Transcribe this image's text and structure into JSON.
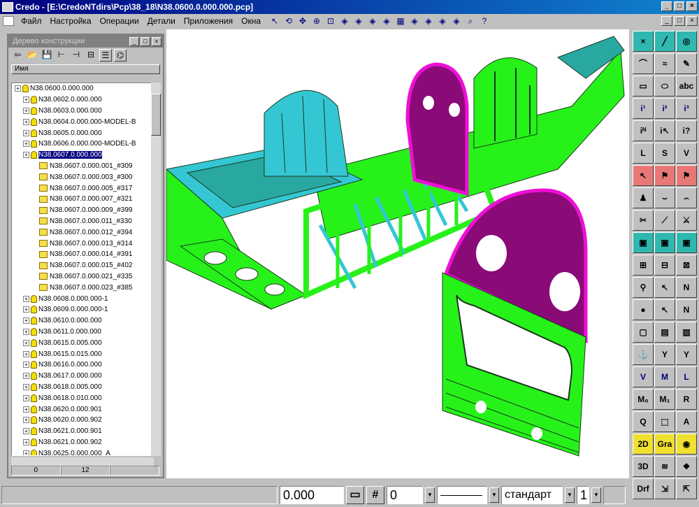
{
  "window": {
    "title": "Credo - [E:\\CredoNTdirs\\Pcp\\38_18\\N38.0600.0.000.000.pcp]",
    "minimize_glyph": "_",
    "maximize_glyph": "□",
    "close_glyph": "×"
  },
  "menu": {
    "items": [
      "Файл",
      "Настройка",
      "Операции",
      "Детали",
      "Приложения",
      "Окна"
    ],
    "toolbar_icons": [
      "pointer-icon",
      "rotate-icon",
      "pan-icon",
      "zoom-icon",
      "zoom-window-icon",
      "view-icon",
      "grid-icon",
      "help-icon"
    ],
    "help_glyph": "?"
  },
  "tree_panel": {
    "title": "Дерево конструкции",
    "column_header": "Имя",
    "toolbar_icons": [
      "back-icon",
      "open-icon",
      "save-icon",
      "hierarchy-icon",
      "hierarchy2-icon",
      "split-icon",
      "list-icon",
      "tree-view-icon"
    ],
    "rows": [
      {
        "label": "N38.0600.0.000.000",
        "level": 0,
        "selected": false,
        "kind": "root"
      },
      {
        "label": "N38.0602.0.000.000",
        "level": 1,
        "selected": false,
        "kind": "bulb"
      },
      {
        "label": "N38.0603.0.000.000",
        "level": 1,
        "selected": false,
        "kind": "bulb"
      },
      {
        "label": "N38.0604.0.000.000-MODEL-B",
        "level": 1,
        "selected": false,
        "kind": "bulb"
      },
      {
        "label": "N38.0605.0.000.000",
        "level": 1,
        "selected": false,
        "kind": "bulb"
      },
      {
        "label": "N38.0606.0.000.000-MODEL-B",
        "level": 1,
        "selected": false,
        "kind": "bulb"
      },
      {
        "label": "N38.0607.0.000.000",
        "level": 1,
        "selected": true,
        "kind": "bulb"
      },
      {
        "label": "N38.0607.0.000.001_#309",
        "level": 2,
        "selected": false,
        "kind": "folder"
      },
      {
        "label": "N38.0607.0.000.003_#300",
        "level": 2,
        "selected": false,
        "kind": "folder"
      },
      {
        "label": "N38.0607.0.000.005_#317",
        "level": 2,
        "selected": false,
        "kind": "folder"
      },
      {
        "label": "N38.0607.0.000.007_#321",
        "level": 2,
        "selected": false,
        "kind": "folder"
      },
      {
        "label": "N38.0607.0.000.009_#399",
        "level": 2,
        "selected": false,
        "kind": "folder"
      },
      {
        "label": "N38.0607.0.000.011_#330",
        "level": 2,
        "selected": false,
        "kind": "folder"
      },
      {
        "label": "N38.0607.0.000.012_#394",
        "level": 2,
        "selected": false,
        "kind": "folder"
      },
      {
        "label": "N38.0607.0.000.013_#314",
        "level": 2,
        "selected": false,
        "kind": "folder"
      },
      {
        "label": "N38.0607.0.000.014_#391",
        "level": 2,
        "selected": false,
        "kind": "folder"
      },
      {
        "label": "N38.0607.0.000.015_#402",
        "level": 2,
        "selected": false,
        "kind": "folder"
      },
      {
        "label": "N38.0607.0.000.021_#335",
        "level": 2,
        "selected": false,
        "kind": "folder"
      },
      {
        "label": "N38.0607.0.000.023_#385",
        "level": 2,
        "selected": false,
        "kind": "folder"
      },
      {
        "label": "N38.0608.0.000.000-1",
        "level": 1,
        "selected": false,
        "kind": "bulb"
      },
      {
        "label": "N38.0609.0.000.000-1",
        "level": 1,
        "selected": false,
        "kind": "bulb"
      },
      {
        "label": "N38.0610.0.000.000",
        "level": 1,
        "selected": false,
        "kind": "bulb"
      },
      {
        "label": "N38.0611.0.000.000",
        "level": 1,
        "selected": false,
        "kind": "bulb"
      },
      {
        "label": "N38.0615.0.005.000",
        "level": 1,
        "selected": false,
        "kind": "bulb"
      },
      {
        "label": "N38.0615.0.015.000",
        "level": 1,
        "selected": false,
        "kind": "bulb"
      },
      {
        "label": "N38.0616.0.000.000",
        "level": 1,
        "selected": false,
        "kind": "bulb"
      },
      {
        "label": "N38.0617.0.000.000",
        "level": 1,
        "selected": false,
        "kind": "bulb"
      },
      {
        "label": "N38.0618.0.005.000",
        "level": 1,
        "selected": false,
        "kind": "bulb"
      },
      {
        "label": "N38.0618.0.010.000",
        "level": 1,
        "selected": false,
        "kind": "bulb"
      },
      {
        "label": "N38.0620.0.000.901",
        "level": 1,
        "selected": false,
        "kind": "bulb"
      },
      {
        "label": "N38.0620.0.000.902",
        "level": 1,
        "selected": false,
        "kind": "bulb"
      },
      {
        "label": "N38.0621.0.000.901",
        "level": 1,
        "selected": false,
        "kind": "bulb"
      },
      {
        "label": "N38.0621.0.000.902",
        "level": 1,
        "selected": false,
        "kind": "bulb"
      },
      {
        "label": "N38.0625.0.000.000_A",
        "level": 1,
        "selected": false,
        "kind": "bulb"
      }
    ],
    "status": [
      "0",
      "12",
      ""
    ]
  },
  "palette": {
    "buttons": [
      {
        "name": "snap-point-button",
        "glyph": "×",
        "style": "active"
      },
      {
        "name": "line-button",
        "glyph": "╱",
        "style": "active"
      },
      {
        "name": "circle-snap-button",
        "glyph": "◎",
        "style": "active"
      },
      {
        "name": "arc-button",
        "glyph": "⌒",
        "style": ""
      },
      {
        "name": "spline-button",
        "glyph": "≈",
        "style": ""
      },
      {
        "name": "pencil-button",
        "glyph": "✎",
        "style": ""
      },
      {
        "name": "rectangle-button",
        "glyph": "▭",
        "style": ""
      },
      {
        "name": "ellipse-button",
        "glyph": "⬭",
        "style": ""
      },
      {
        "name": "text-button",
        "glyph": "abc",
        "style": ""
      },
      {
        "name": "info1-button",
        "glyph": "i¹",
        "style": "blue"
      },
      {
        "name": "info2-button",
        "glyph": "i²",
        "style": "blue"
      },
      {
        "name": "info3-button",
        "glyph": "i³",
        "style": "blue"
      },
      {
        "name": "info-n-button",
        "glyph": "iᴺ",
        "style": ""
      },
      {
        "name": "info-pick-button",
        "glyph": "i↖",
        "style": ""
      },
      {
        "name": "info-query-button",
        "glyph": "i?",
        "style": ""
      },
      {
        "name": "measure-l-button",
        "glyph": "L",
        "style": ""
      },
      {
        "name": "measure-s-button",
        "glyph": "S",
        "style": ""
      },
      {
        "name": "measure-v-button",
        "glyph": "V",
        "style": ""
      },
      {
        "name": "select-red1-button",
        "glyph": "↖",
        "style": "pink"
      },
      {
        "name": "select-red2-button",
        "glyph": "⚑",
        "style": "pink"
      },
      {
        "name": "select-red3-button",
        "glyph": "⚑",
        "style": "pink"
      },
      {
        "name": "people-button",
        "glyph": "♟",
        "style": ""
      },
      {
        "name": "curve-button",
        "glyph": "⌣",
        "style": ""
      },
      {
        "name": "curve2-button",
        "glyph": "⌢",
        "style": ""
      },
      {
        "name": "cut-button",
        "glyph": "✂",
        "style": ""
      },
      {
        "name": "diag-button",
        "glyph": "⟋",
        "style": ""
      },
      {
        "name": "knife-button",
        "glyph": "⚔",
        "style": ""
      },
      {
        "name": "comp1-button",
        "glyph": "▣",
        "style": "active"
      },
      {
        "name": "comp2-button",
        "glyph": "▣",
        "style": "active"
      },
      {
        "name": "comp3-button",
        "glyph": "▣",
        "style": "active"
      },
      {
        "name": "tool1-button",
        "glyph": "⊞",
        "style": ""
      },
      {
        "name": "tool2-button",
        "glyph": "⊟",
        "style": ""
      },
      {
        "name": "tool3-button",
        "glyph": "⊠",
        "style": ""
      },
      {
        "name": "wrench-button",
        "glyph": "⚲",
        "style": ""
      },
      {
        "name": "arrow-button",
        "glyph": "↖",
        "style": ""
      },
      {
        "name": "n-button",
        "glyph": "N",
        "style": ""
      },
      {
        "name": "bulb-button",
        "glyph": "●",
        "style": ""
      },
      {
        "name": "arrow2-button",
        "glyph": "↖",
        "style": ""
      },
      {
        "name": "n2-button",
        "glyph": "N",
        "style": ""
      },
      {
        "name": "frame-button",
        "glyph": "▢",
        "style": ""
      },
      {
        "name": "frame2-button",
        "glyph": "▤",
        "style": ""
      },
      {
        "name": "frame3-button",
        "glyph": "▥",
        "style": ""
      },
      {
        "name": "anchor-button",
        "glyph": "⚓",
        "style": ""
      },
      {
        "name": "fork-button",
        "glyph": "Y",
        "style": ""
      },
      {
        "name": "fork2-button",
        "glyph": "Y",
        "style": ""
      },
      {
        "name": "v-button",
        "glyph": "V",
        "style": "blue"
      },
      {
        "name": "m-button",
        "glyph": "M",
        "style": "blue"
      },
      {
        "name": "l-button",
        "glyph": "L",
        "style": "blue"
      },
      {
        "name": "m0-button",
        "glyph": "M₀",
        "style": ""
      },
      {
        "name": "m1-button",
        "glyph": "M₁",
        "style": ""
      },
      {
        "name": "r-button",
        "glyph": "R",
        "style": ""
      },
      {
        "name": "q-button",
        "glyph": "Q",
        "style": ""
      },
      {
        "name": "select-box-button",
        "glyph": "⬚",
        "style": ""
      },
      {
        "name": "a-button",
        "glyph": "A",
        "style": ""
      },
      {
        "name": "2d-button",
        "glyph": "2D",
        "style": "yellow"
      },
      {
        "name": "gra-button",
        "glyph": "Gra",
        "style": "yellow"
      },
      {
        "name": "lips-button",
        "glyph": "◉",
        "style": "yellow"
      },
      {
        "name": "3d-button",
        "glyph": "3D",
        "style": ""
      },
      {
        "name": "hatch-button",
        "glyph": "≋",
        "style": ""
      },
      {
        "name": "pattern-button",
        "glyph": "❖",
        "style": ""
      },
      {
        "name": "drf-button",
        "glyph": "Drf",
        "style": ""
      },
      {
        "name": "scale-button",
        "glyph": "⇲",
        "style": ""
      },
      {
        "name": "scale2-button",
        "glyph": "⇱",
        "style": ""
      }
    ]
  },
  "statusbar": {
    "value": "0.000",
    "hash": "#",
    "layer": "0",
    "style": "стандарт",
    "scale": "1"
  },
  "colors": {
    "green": "#26f21a",
    "cyan": "#34c7d3",
    "magenta": "#8a0a78",
    "pink": "#ee10d6",
    "teal": "#28a8a0",
    "dark": "#1a3a1a"
  }
}
